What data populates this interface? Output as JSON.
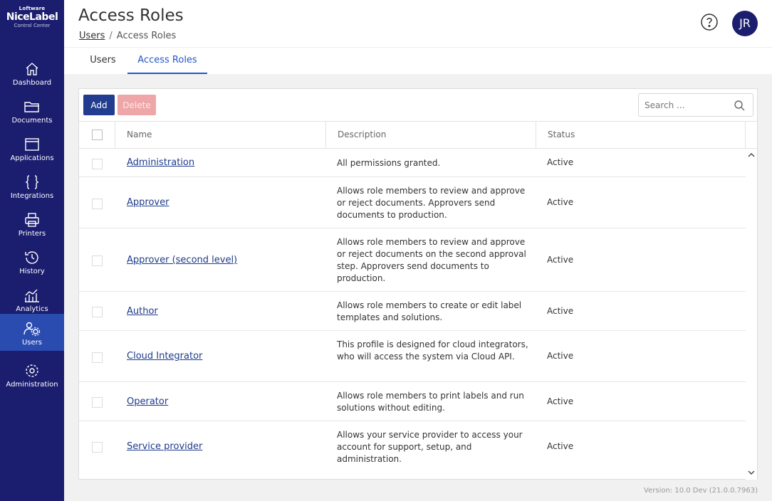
{
  "brand": {
    "company": "Loftware",
    "product": "NiceLabel",
    "subtitle": "Control Center"
  },
  "sidebar": {
    "items": [
      {
        "label": "Dashboard",
        "icon": "home-icon"
      },
      {
        "label": "Documents",
        "icon": "folder-icon"
      },
      {
        "label": "Applications",
        "icon": "window-icon"
      },
      {
        "label": "Integrations",
        "icon": "braces-icon"
      },
      {
        "label": "Printers",
        "icon": "printer-icon"
      },
      {
        "label": "History",
        "icon": "history-icon"
      },
      {
        "label": "Analytics",
        "icon": "analytics-icon"
      },
      {
        "label": "Users",
        "icon": "users-gear-icon",
        "active": true
      },
      {
        "label": "Administration",
        "icon": "gear-icon"
      }
    ]
  },
  "header": {
    "title": "Access Roles",
    "breadcrumb": {
      "parent": "Users",
      "separator": "/",
      "current": "Access Roles"
    },
    "avatar_initials": "JR"
  },
  "tabs": [
    {
      "label": "Users"
    },
    {
      "label": "Access Roles",
      "active": true
    }
  ],
  "toolbar": {
    "add_label": "Add",
    "delete_label": "Delete",
    "search_placeholder": "Search ..."
  },
  "table": {
    "columns": [
      "Name",
      "Description",
      "Status"
    ],
    "rows": [
      {
        "name": "Administration",
        "description": "All permissions granted.",
        "status": "Active"
      },
      {
        "name": "Approver",
        "description": "Allows role members to review and approve or reject documents. Approvers send documents to production.",
        "status": "Active"
      },
      {
        "name": "Approver (second level)",
        "description": "Allows role members to review and approve or reject documents on the second approval step. Approvers send documents to production.",
        "status": "Active"
      },
      {
        "name": "Author",
        "description": "Allows role members to create or edit label templates and solutions.",
        "status": "Active"
      },
      {
        "name": "Cloud Integrator",
        "description": "This profile is designed for cloud integrators, who will access the system via Cloud API.",
        "status": "Active"
      },
      {
        "name": "Operator",
        "description": "Allows role members to print labels and run solutions without editing.",
        "status": "Active"
      },
      {
        "name": "Service provider",
        "description": "Allows your service provider to access your account for support, setup, and administration.",
        "status": "Active"
      }
    ]
  },
  "footer": {
    "version": "Version: 10.0 Dev (21.0.0.7963)"
  },
  "colors": {
    "sidebar_bg": "#1b1d6e",
    "sidebar_active": "#2a4bb0",
    "accent": "#2257c7",
    "add_button": "#223c8f",
    "delete_button_disabled": "#eea6a8",
    "link": "#1d3b8c"
  }
}
